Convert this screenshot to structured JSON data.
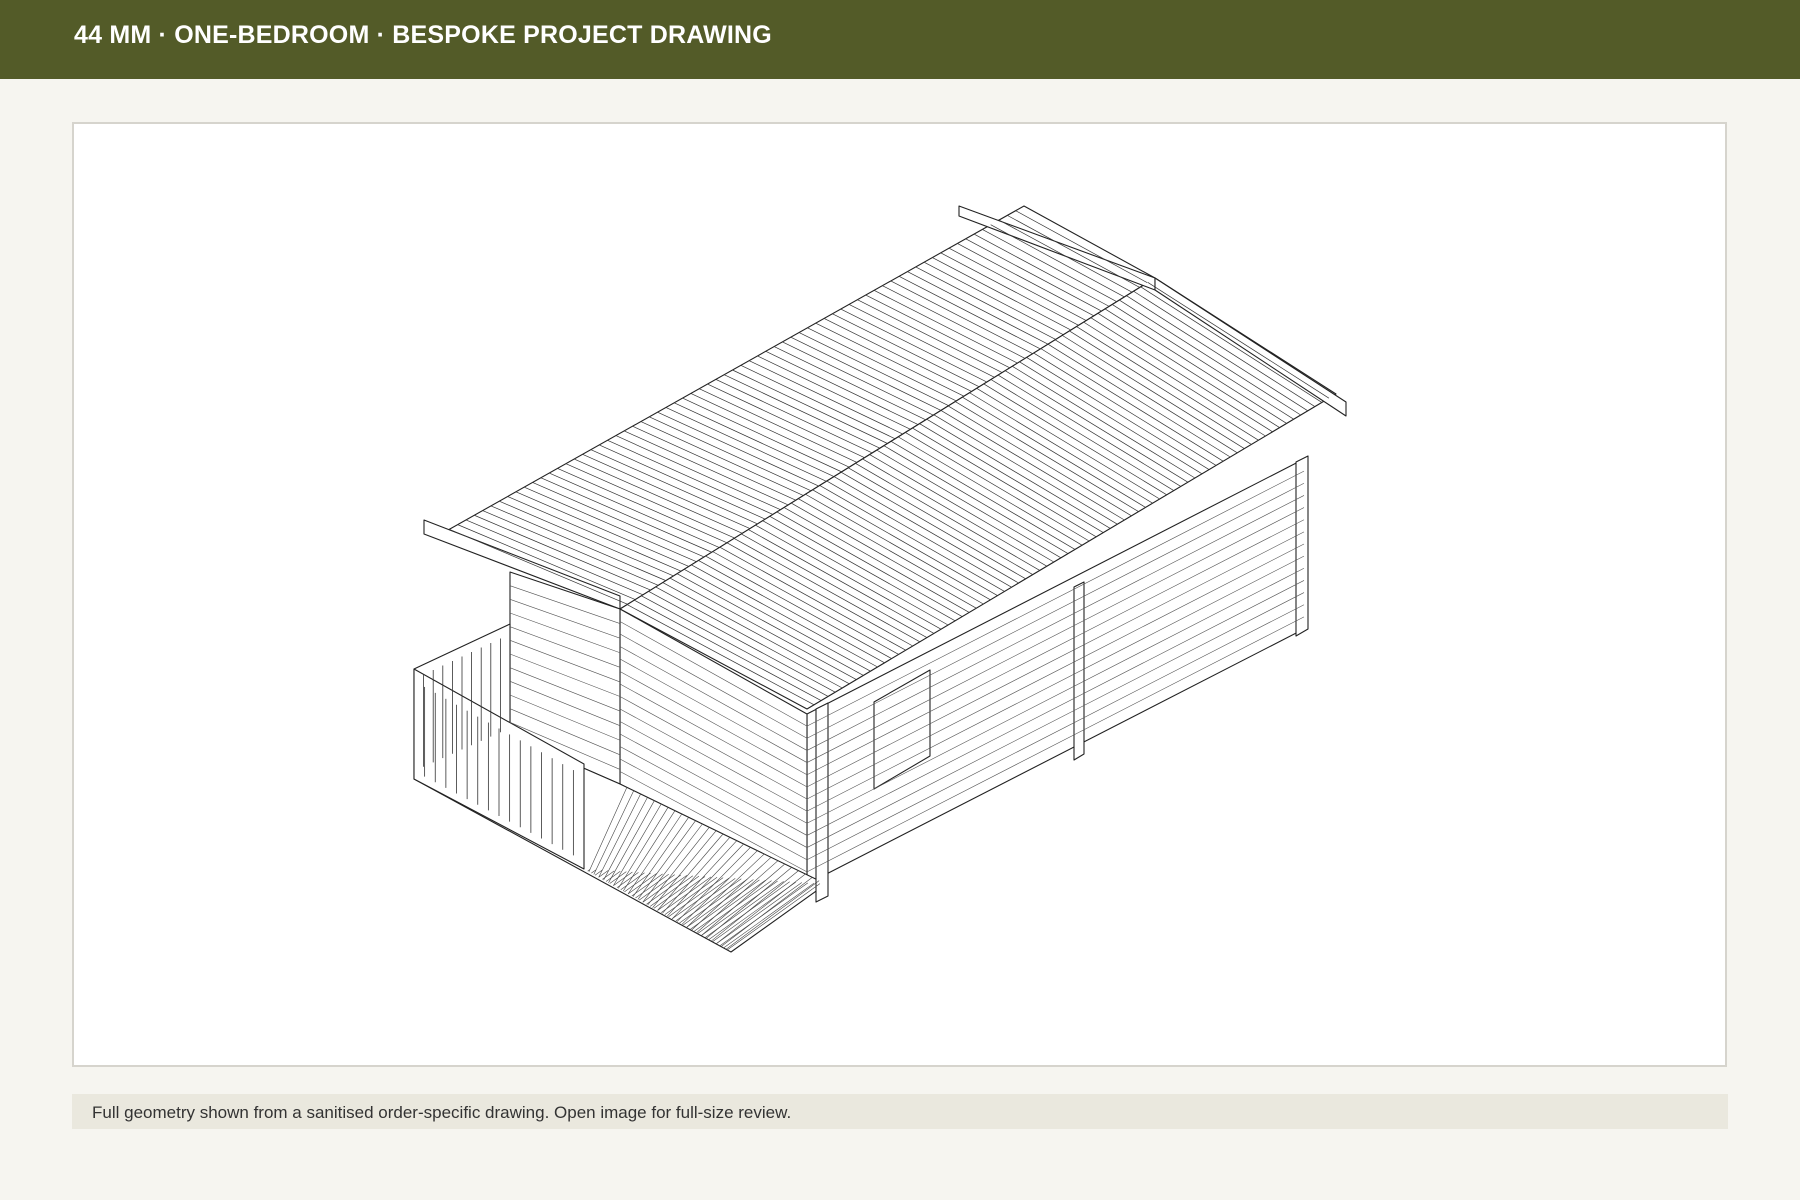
{
  "header": {
    "title": "44 MM · ONE-BEDROOM · BESPOKE PROJECT DRAWING",
    "background": "#535b28"
  },
  "drawing": {
    "image_kind": "isometric line drawing of log cabin with veranda"
  },
  "caption": {
    "text": "Full geometry shown from a sanitised order-specific drawing. Open image for full-size review."
  }
}
